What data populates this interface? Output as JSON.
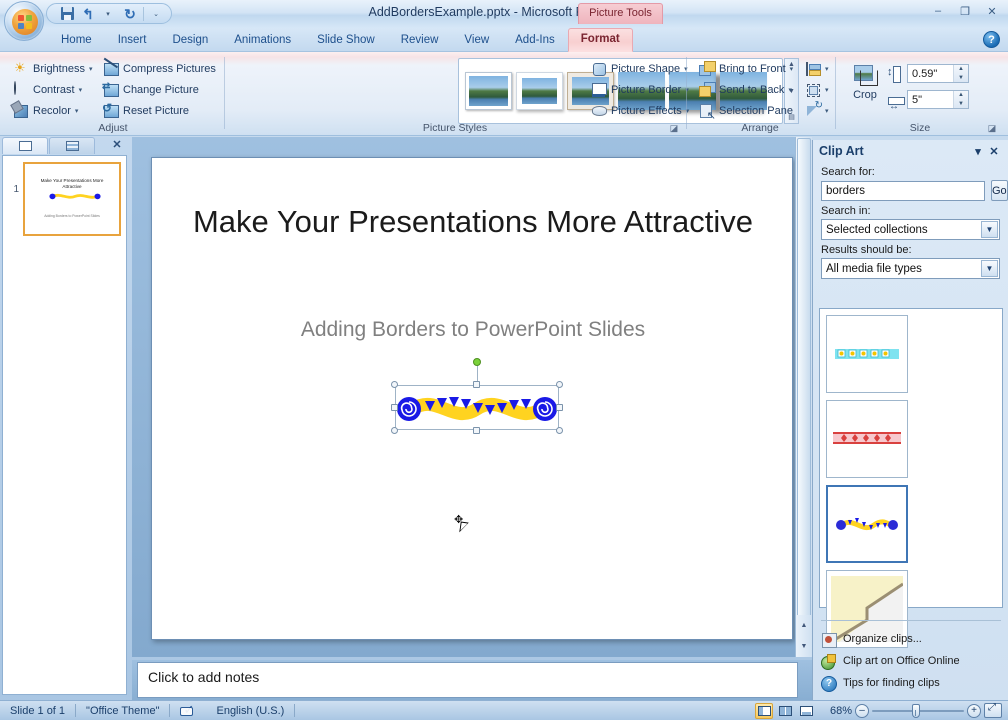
{
  "window": {
    "document_title": "AddBordersExample.pptx",
    "app_name": "Microsoft PowerPoint",
    "title_separator": "-",
    "contextual_tab_label": "Picture Tools",
    "minimize": "–",
    "maximize": "❐",
    "close": "✕",
    "help": "?"
  },
  "quick_access": {
    "save": "Save",
    "undo": "Undo",
    "undo_caret": "▾",
    "redo": "Redo",
    "customize_caret": "▾"
  },
  "tabs": [
    {
      "label": "Home",
      "active": false
    },
    {
      "label": "Insert",
      "active": false
    },
    {
      "label": "Design",
      "active": false
    },
    {
      "label": "Animations",
      "active": false
    },
    {
      "label": "Slide Show",
      "active": false
    },
    {
      "label": "Review",
      "active": false
    },
    {
      "label": "View",
      "active": false
    },
    {
      "label": "Add-Ins",
      "active": false
    },
    {
      "label": "Format",
      "active": true
    }
  ],
  "ribbon": {
    "adjust": {
      "title": "Adjust",
      "items": [
        {
          "label": "Brightness",
          "icon": "brightness-icon",
          "has_caret": true
        },
        {
          "label": "Contrast",
          "icon": "contrast-icon",
          "has_caret": true
        },
        {
          "label": "Recolor",
          "icon": "recolor-icon",
          "has_caret": true
        },
        {
          "label": "Compress Pictures",
          "icon": "compress-pictures-icon",
          "has_caret": false
        },
        {
          "label": "Change Picture",
          "icon": "change-picture-icon",
          "has_caret": false
        },
        {
          "label": "Reset Picture",
          "icon": "reset-picture-icon",
          "has_caret": false
        }
      ]
    },
    "picture_styles": {
      "title": "Picture Styles",
      "gallery_count": 6,
      "scroll_up": "▲",
      "scroll_down": "▼",
      "more": "▤",
      "dialog_launcher": "⌐",
      "items": [
        {
          "label": "Picture Shape",
          "icon": "picture-shape-icon",
          "has_caret": true
        },
        {
          "label": "Picture Border",
          "icon": "picture-border-icon",
          "has_caret": true
        },
        {
          "label": "Picture Effects",
          "icon": "picture-effects-icon",
          "has_caret": true
        }
      ]
    },
    "arrange": {
      "title": "Arrange",
      "items": [
        {
          "label": "Bring to Front",
          "icon": "bring-to-front-icon",
          "has_caret": true
        },
        {
          "label": "Send to Back",
          "icon": "send-to-back-icon",
          "has_caret": true
        },
        {
          "label": "Selection Pane",
          "icon": "selection-pane-icon",
          "has_caret": false
        }
      ],
      "mini_items": [
        {
          "icon": "align-icon",
          "has_caret": true
        },
        {
          "icon": "group-icon",
          "has_caret": true
        },
        {
          "icon": "rotate-icon",
          "has_caret": true
        }
      ]
    },
    "size": {
      "title": "Size",
      "crop_label": "Crop",
      "height_value": "0.59\"",
      "width_value": "5\"",
      "spin_up": "▲",
      "spin_down": "▼",
      "dialog_launcher": "⌐"
    }
  },
  "slides_pane": {
    "tab_slides": "Slides",
    "tab_outline": "Outline",
    "close": "✕",
    "slides": [
      {
        "number": "1",
        "title": "Make Your Presentations More Attractive",
        "subtitle": "Adding Borders to PowerPoint Slides"
      }
    ]
  },
  "slide": {
    "title": "Make Your Presentations More Attractive",
    "subtitle": "Adding Borders to PowerPoint Slides",
    "selected_object": "clip-art-border"
  },
  "notes": {
    "placeholder": "Click to add notes"
  },
  "clip_art_pane": {
    "title": "Clip Art",
    "menu_caret": "▾",
    "close": "✕",
    "search_for_label": "Search for:",
    "search_value": "borders",
    "go_label": "Go",
    "search_in_label": "Search in:",
    "search_in_value": "Selected collections",
    "results_label": "Results should be:",
    "results_value": "All media file types",
    "results": [
      {
        "name": "blue-square-dots-border",
        "selected": false
      },
      {
        "name": "red-diamond-border",
        "selected": false
      },
      {
        "name": "yellow-wave-swirl-border",
        "selected": true
      },
      {
        "name": "corner-angle-border",
        "selected": false
      }
    ],
    "links": [
      {
        "label": "Organize clips...",
        "icon": "organize-clips-icon"
      },
      {
        "label": "Clip art on Office Online",
        "icon": "office-online-icon"
      },
      {
        "label": "Tips for finding clips",
        "icon": "tips-icon"
      }
    ]
  },
  "status_bar": {
    "slide_indicator": "Slide 1 of 1",
    "theme": "\"Office Theme\"",
    "language": "English (U.S.)",
    "spell_icon": "spell-check-icon",
    "views": [
      {
        "name": "normal-view",
        "active": true
      },
      {
        "name": "slide-sorter-view",
        "active": false
      },
      {
        "name": "slide-show-view",
        "active": false
      }
    ],
    "zoom_level": "68%",
    "zoom_out": "–",
    "zoom_in": "+",
    "fit_to_window": "Fit slide to current window"
  },
  "colors": {
    "accent": "#1d4f8c",
    "contextual_tab": "#7a2430",
    "clipart_yellow": "#FFD320",
    "clipart_blue": "#1A1AE6",
    "selection_green": "#7ad13a"
  }
}
